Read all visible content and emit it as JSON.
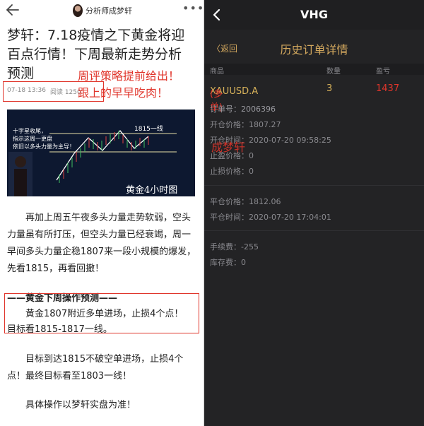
{
  "left": {
    "author": "分析师成梦轩",
    "title_lines": [
      "梦轩：7.18疫情之下黄金将迎",
      "百点行情！下周最新走势分析",
      "预测"
    ],
    "meta_date": "07-18 13:36",
    "meta_reads": "阅读 1250",
    "overlay_note_lines": [
      "周评策略提前给出！",
      "跟上的早早吃肉！"
    ],
    "chart": {
      "note_lines": [
        "十字星收尾，",
        "指示这周一更盘",
        "依旧以多头力量为主导！"
      ],
      "line_label": "1815一线",
      "caption": "黄金4小时图"
    },
    "para1": "再加上周五午夜多头力量走势软弱，空头力量虽有所打压，但空头力量已经衰竭，周一早间多头力量企稳1807来一段小规模的爆发，先看1815，再看回撤！",
    "section_head": "——黄金下周操作预测——",
    "section_l1": "黄金1807附近多单进场，止损4个点！",
    "section_l2": "目标看1815-1817一线。",
    "para2": "目标到达1815不破空单进场，止损4个点！最终目标看至1803一线！",
    "para3": "具体操作以梦轩实盘为准！"
  },
  "right": {
    "app_title": "VHG",
    "return_label": "〈返回",
    "sub_title": "历史订单详情",
    "col_headers": [
      "商品",
      "数量",
      "盈亏"
    ],
    "symbol": "XAUUSD.A",
    "order_tag": "(多单)",
    "quantity": "3",
    "profit": "1437",
    "order_no_label": "订单号：",
    "order_no": "2006396",
    "open_price_label": "开仓价格：",
    "open_price": "1807.27",
    "open_time_label": "开仓时间：",
    "open_time": "2020-07-20 09:58:25",
    "tp_label": "止盈价格：",
    "tp": "0",
    "sl_label": "止损价格：",
    "sl": "0",
    "close_price_label": "平仓价格：",
    "close_price": "1812.06",
    "close_time_label": "平仓时间：",
    "close_time": "2020-07-20 17:04:01",
    "fee_label": "手续费：",
    "fee": "-255",
    "swap_label": "库存费：",
    "swap": "0",
    "watermark": "成梦轩"
  },
  "colors": {
    "accent_red": "#e0352b",
    "gold": "#d3a85e",
    "dark_bg": "#232325"
  }
}
